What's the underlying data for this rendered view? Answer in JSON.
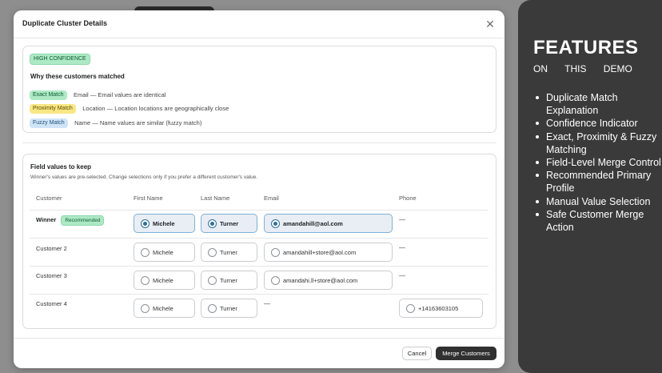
{
  "modal": {
    "title": "Duplicate Cluster Details",
    "close_icon": "close-icon",
    "confidence_badge": "HIGH CONFIDENCE",
    "why_title": "Why these customers matched",
    "reasons": [
      {
        "badge": "Exact Match",
        "text": "Email — Email values are identical"
      },
      {
        "badge": "Proximity Match",
        "text": "Location — Location locations are geographically close"
      },
      {
        "badge": "Fuzzy Match",
        "text": "Name — Name values are similar (fuzzy match)"
      }
    ],
    "field_values": {
      "title": "Field values to keep",
      "subtitle": "Winner's values are pre-selected. Change selections only if you prefer a different customer's value.",
      "headers": [
        "Customer",
        "First Name",
        "Last Name",
        "Email",
        "Phone"
      ],
      "rows": [
        {
          "label": "Winner",
          "badge": "Recommended",
          "first": "Michele",
          "last": "Turner",
          "email": "amandahill@aol.com",
          "phone": "—",
          "selected": true
        },
        {
          "label": "Customer 2",
          "first": "Michele",
          "last": "Turner",
          "email": "amandahill+store@aol.com",
          "phone": "—",
          "selected": false
        },
        {
          "label": "Customer 3",
          "first": "Michele",
          "last": "Turner",
          "email": "amandahi.ll+store@aol.com",
          "phone": "—",
          "selected": false
        },
        {
          "label": "Customer 4",
          "first": "Michele",
          "last": "Turner",
          "email": "—",
          "phone": "+14163603105",
          "selected": false
        }
      ]
    },
    "cancel_label": "Cancel",
    "merge_label": "Merge Customers"
  },
  "features": {
    "title": "FEATURES",
    "subtitle": "ON THIS DEMO",
    "items": [
      "Duplicate Match Explanation",
      "Confidence Indicator",
      "Exact, Proximity & Fuzzy Matching",
      "Field-Level Merge Control",
      "Recommended Primary Profile",
      "Manual Value Selection",
      "Safe Customer Merge Action"
    ]
  },
  "colors": {
    "primary_button": "#303030",
    "selected_accent": "#2e6f9e",
    "exact_badge": "#aee9c5",
    "proximity_badge": "#f9e784",
    "fuzzy_badge": "#cfe5f7",
    "side_panel": "#3a3a3a"
  }
}
